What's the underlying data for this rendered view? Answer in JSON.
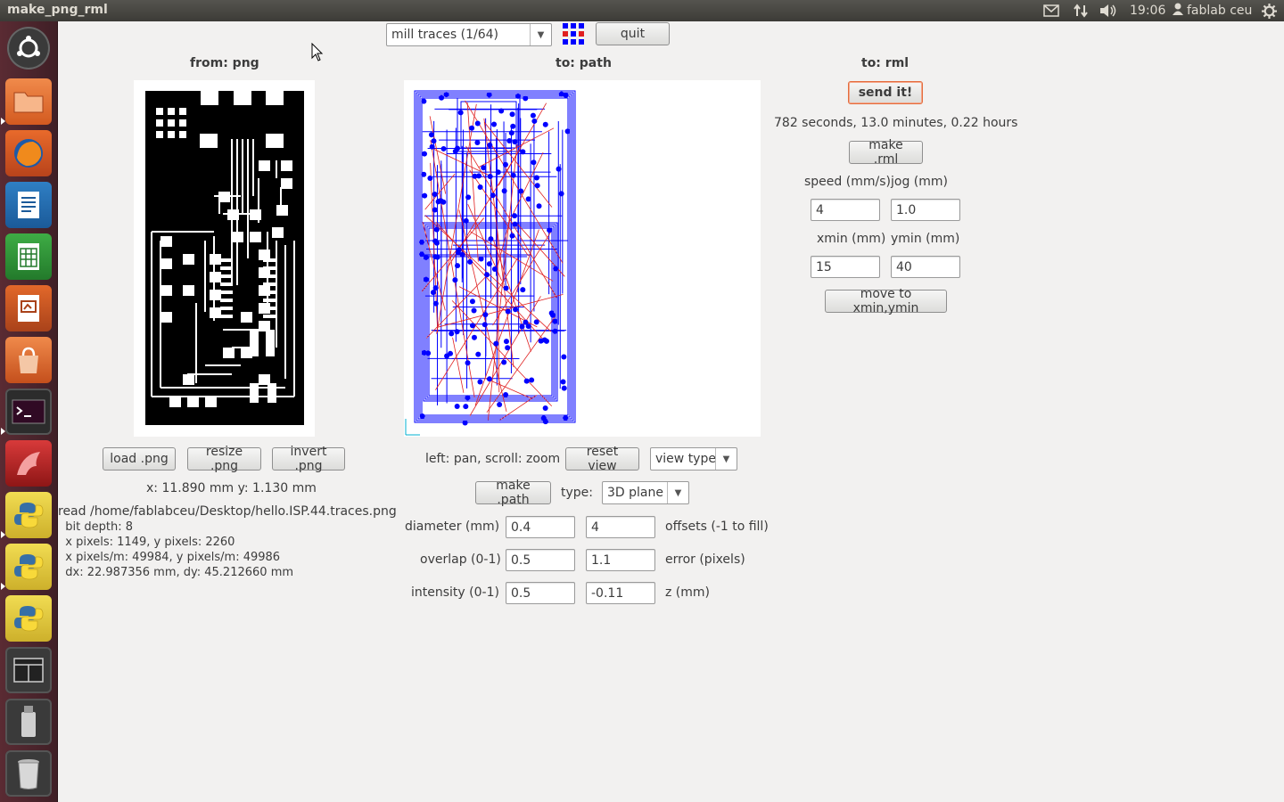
{
  "topbar": {
    "title": "make_png_rml",
    "time": "19:06",
    "user": "fablab ceu"
  },
  "launcher": {
    "items": [
      "ubuntu-dash",
      "files",
      "firefox",
      "writer",
      "calc",
      "impress",
      "software-center",
      "terminal",
      "app-red",
      "python-1",
      "python-2",
      "python-3",
      "workspace-switcher",
      "usb-drive",
      "trash"
    ]
  },
  "toolbar": {
    "mode_selected": "mill traces (1/64)",
    "quit_label": "quit"
  },
  "png": {
    "header": "from: png",
    "load_label": "load .png",
    "resize_label": "resize .png",
    "invert_label": "invert .png",
    "coords": "x: 11.890 mm  y: 1.130 mm",
    "info": [
      "read /home/fablabceu/Desktop/hello.ISP.44.traces.png",
      "  bit depth: 8",
      "  x pixels: 1149, y pixels: 2260",
      "  x pixels/m: 49984, y pixels/m: 49986",
      "  dx: 22.987356 mm, dy: 45.212660 mm"
    ]
  },
  "path": {
    "header": "to: path",
    "hint": "left: pan, scroll: zoom",
    "reset_label": "reset view",
    "view_type": "view type",
    "make_label": "make .path",
    "type_label": "type:",
    "type_value": "3D plane",
    "diameter_label": "diameter (mm)",
    "diameter_value": "0.4",
    "offsets_value": "4",
    "offsets_label": "offsets (-1 to fill)",
    "overlap_label": "overlap (0-1)",
    "overlap_value": "0.5",
    "error_value": "1.1",
    "error_label": "error (pixels)",
    "intensity_label": "intensity (0-1)",
    "intensity_value": "0.5",
    "z_value": "-0.11",
    "z_label": "z (mm)"
  },
  "rml": {
    "header": "to: rml",
    "send_label": "send it!",
    "time_estimate": "782 seconds, 13.0 minutes, 0.22 hours",
    "make_label": "make .rml",
    "speed_label": "speed (mm/s)",
    "jog_label": "jog (mm)",
    "speed_value": "4",
    "jog_value": "1.0",
    "xmin_label": "xmin (mm)",
    "ymin_label": "ymin (mm)",
    "xmin_value": "15",
    "ymin_value": "40",
    "move_label": "move to xmin,ymin"
  },
  "colors": {
    "path_blue": "#0000ff",
    "path_red": "#e02020",
    "accent": "#e46c3d",
    "panel_bg": "#f2f1f0",
    "launcher_bg": "#4a242b"
  }
}
